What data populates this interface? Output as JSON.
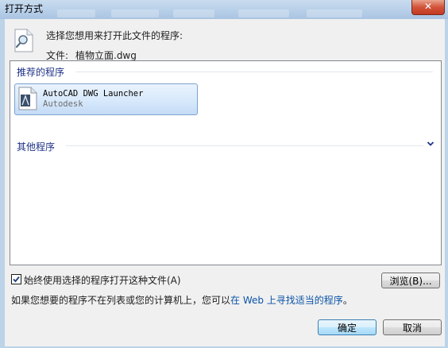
{
  "window": {
    "title": "打开方式",
    "close_label": "✕"
  },
  "dialog": {
    "prompt": "选择您想用来打开此文件的程序:",
    "file_label": "文件:",
    "file_name": "植物立面.dwg"
  },
  "program_list": {
    "recommended_header": "推荐的程序",
    "other_header": "其他程序",
    "items": [
      {
        "name": "AutoCAD DWG Launcher",
        "vendor": "Autodesk"
      }
    ]
  },
  "options": {
    "always_use_label": "始终使用选择的程序打开这种文件(A)",
    "always_use_checked": true,
    "browse_label": "浏览(B)..."
  },
  "footer": {
    "info_prefix": "如果您想要的程序不在列表或您的计算机上，您可以",
    "info_link": "在 Web 上寻找适当的程序",
    "info_suffix": "。",
    "ok_label": "确定",
    "cancel_label": "取消"
  },
  "colors": {
    "accent_text": "#1e3287",
    "link": "#0b54a8",
    "selection_border": "#7da2ce"
  }
}
